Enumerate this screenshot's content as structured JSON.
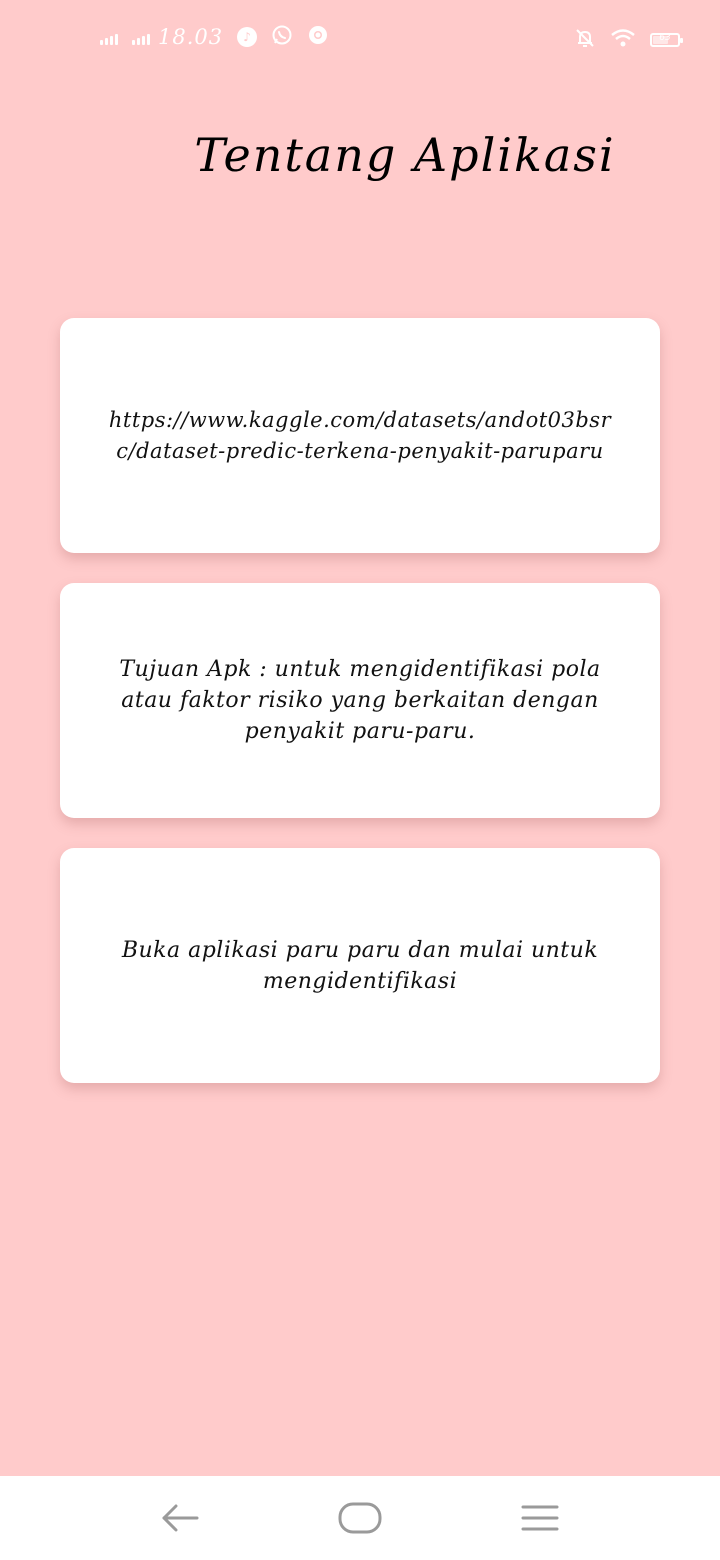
{
  "status_bar": {
    "time": "18.03",
    "left_icons": [
      "signal-icon",
      "signal-icon",
      "tiktok-icon",
      "whatsapp-icon",
      "chrome-icon"
    ],
    "right_icons": [
      "notifications-off-icon",
      "wifi-icon",
      "battery-icon"
    ],
    "battery_text": "63",
    "battery_level": 0.63
  },
  "page": {
    "title": "Tentang Aplikasi"
  },
  "cards": [
    {
      "text": "https://www.kaggle.com/datasets/andot03bsrc/dataset-predic-terkena-penyakit-paruparu"
    },
    {
      "text": "Tujuan Apk : untuk mengidentifikasi pola atau faktor risiko yang berkaitan dengan penyakit paru-paru."
    },
    {
      "text": "Buka aplikasi paru paru dan mulai untuk mengidentifikasi"
    }
  ],
  "nav_bar": {
    "buttons": [
      "back-icon",
      "home-icon",
      "recents-menu-icon"
    ]
  },
  "colors": {
    "background": "#ffcbcb",
    "card": "#ffffff",
    "text": "#111111",
    "nav_icon": "#9a9a9a"
  }
}
